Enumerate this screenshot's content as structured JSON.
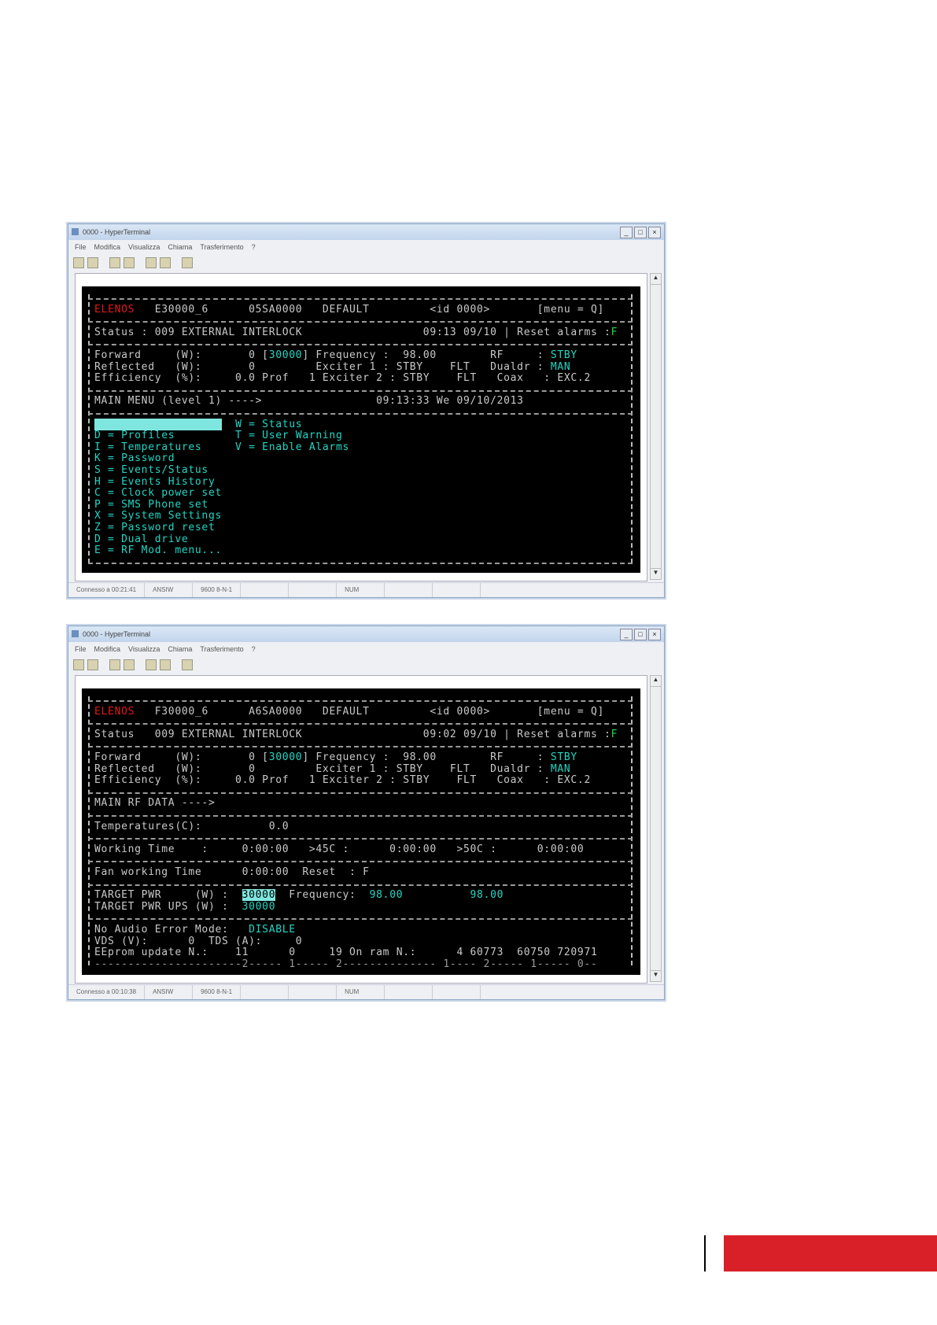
{
  "colors": {
    "accent": "#d92028",
    "terminal_bg": "#000000",
    "cyan": "#22d6c4",
    "red": "#e01818",
    "green": "#27d84a"
  },
  "windows": [
    {
      "title": "0000 - HyperTerminal",
      "menu": [
        "File",
        "Modifica",
        "Visualizza",
        "Chiama",
        "Trasferimento",
        "?"
      ],
      "statusbar": [
        "Connesso a 00:21:41",
        "ANSIW",
        "9600 8-N-1",
        "",
        "",
        "NUM",
        "",
        ""
      ],
      "rows": [
        "sep",
        [
          [
            "ELENOS",
            "red"
          ],
          [
            "   E30000_6      05SA0000   DEFAULT         <id 0000>       [menu = Q]",
            ""
          ]
        ],
        "sep",
        [
          [
            "Status : 009 EXTERNAL INTERLOCK                  09:13 09/10 | Reset alarms :",
            ""
          ],
          [
            "F",
            "green"
          ]
        ],
        "sep",
        [
          [
            "Forward     (W):       0 [",
            ""
          ],
          [
            "30000",
            "cyan"
          ],
          [
            "] Frequency :  98.00        RF     : ",
            ""
          ],
          [
            "STBY",
            "cyan"
          ]
        ],
        [
          [
            "Reflected   (W):       0         Exciter 1 : STBY    FLT   Dualdr : ",
            ""
          ],
          [
            "MAN",
            "cyan"
          ]
        ],
        [
          [
            "Efficiency  (%):     0.0 Prof   1 Exciter 2 : STBY    FLT   Coax   : EXC.2",
            ""
          ]
        ],
        "sep",
        [
          [
            "MAIN MENU (level 1) ---->                 09:13:33 We 09/10/2013",
            ""
          ]
        ],
        "sep",
        [
          [
            "                   ",
            "hl"
          ],
          [
            "  W = Status",
            "cyan"
          ]
        ],
        [
          [
            "D = Profiles         T = User Warning",
            "cyan"
          ]
        ],
        [
          [
            "I = Temperatures     V = Enable Alarms",
            "cyan"
          ]
        ],
        [
          [
            "K = Password",
            "cyan"
          ]
        ],
        [
          [
            "S = Events/Status",
            "cyan"
          ]
        ],
        [
          [
            "H = Events History",
            "cyan"
          ]
        ],
        [
          [
            "C = Clock power set",
            "cyan"
          ]
        ],
        [
          [
            "P = SMS Phone set",
            "cyan"
          ]
        ],
        [
          [
            "X = System Settings",
            "cyan"
          ]
        ],
        [
          [
            "Z = Password reset",
            "cyan"
          ]
        ],
        [
          [
            "D = Dual drive",
            "cyan"
          ]
        ],
        [
          [
            "E = RF Mod. menu...",
            "cyan"
          ]
        ],
        "sep"
      ]
    },
    {
      "title": "0000 - HyperTerminal",
      "menu": [
        "File",
        "Modifica",
        "Visualizza",
        "Chiama",
        "Trasferimento",
        "?"
      ],
      "statusbar": [
        "Connesso a 00:10:38",
        "ANSIW",
        "9600 8-N-1",
        "",
        "",
        "NUM",
        "",
        ""
      ],
      "rows": [
        "sep",
        [
          [
            "ELENOS",
            "red"
          ],
          [
            "   F30000_6      A6SA0000   DEFAULT         <id 0000>       [menu = Q]",
            ""
          ]
        ],
        "sep",
        [
          [
            "Status   009 EXTERNAL INTERLOCK                  09:02 09/10 | Reset alarms :",
            ""
          ],
          [
            "F",
            "green"
          ]
        ],
        "sep",
        [
          [
            "Forward     (W):       0 [",
            ""
          ],
          [
            "30000",
            "cyan"
          ],
          [
            "] Frequency :  98.00        RF     : ",
            ""
          ],
          [
            "STBY",
            "cyan"
          ]
        ],
        [
          [
            "Reflected   (W):       0         Exciter 1 : STBY    FLT   Dualdr : ",
            ""
          ],
          [
            "MAN",
            "cyan"
          ]
        ],
        [
          [
            "Efficiency  (%):     0.0 Prof   1 Exciter 2 : STBY    FLT   Coax   : EXC.2",
            ""
          ]
        ],
        "sep",
        [
          [
            "MAIN RF DATA ---->",
            ""
          ]
        ],
        "sep",
        [
          [
            "Temperatures(C):          0.0",
            ""
          ]
        ],
        "sep",
        [
          [
            "Working Time    :     0:00:00   >45C :      0:00:00   >50C :      0:00:00",
            ""
          ]
        ],
        "sep",
        [
          [
            "Fan working Time      0:00:00  Reset  : F",
            ""
          ]
        ],
        "sep",
        [
          [
            "TARGET PWR     (W) :  ",
            ""
          ],
          [
            "30000",
            "hl"
          ],
          [
            "  Frequency:  ",
            ""
          ],
          [
            "98.00",
            "cyan"
          ],
          [
            "          ",
            ""
          ],
          [
            "98.00",
            "cyan"
          ]
        ],
        [
          [
            "TARGET PWR UPS (W) :  ",
            ""
          ],
          [
            "30000",
            "cyan"
          ]
        ],
        "sep",
        [
          [
            "No Audio Error Mode:   ",
            ""
          ],
          [
            "DISABLE",
            "cyan"
          ]
        ],
        [
          [
            "VDS (V):      0  TDS (A):     0",
            ""
          ]
        ],
        [
          [
            "EEprom update N.:    11      0     19 On ram N.:      4 60773  60750 720971",
            ""
          ]
        ],
        [
          [
            "----------------------2----- 1----- 2-------------- 1---- 2----- 1----- 0--",
            "gray"
          ]
        ]
      ]
    }
  ]
}
